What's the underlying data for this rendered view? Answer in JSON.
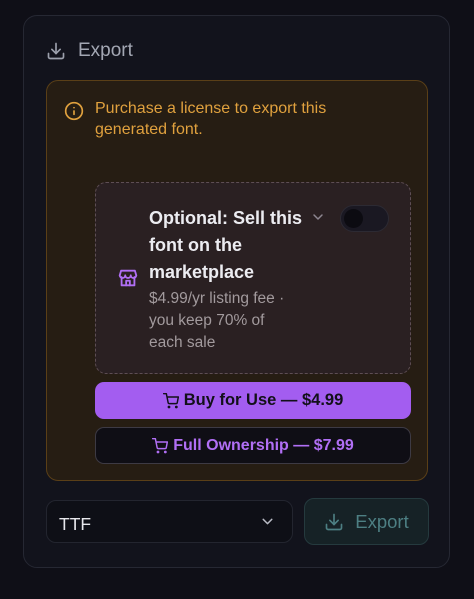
{
  "header": {
    "title": "Export",
    "icon": "download-icon"
  },
  "notice": {
    "icon": "info-icon",
    "text": "Purchase a license to export this generated font."
  },
  "marketplace": {
    "icon": "store-icon",
    "title": "Optional: Sell this font on the marketplace",
    "subtitle": "$4.99/yr listing fee · you keep 70% of each sale",
    "toggle_on": false
  },
  "buttons": {
    "buy_label": "Buy for Use — $4.99",
    "ownership_label": "Full Ownership — $7.99",
    "export_label": "Export"
  },
  "format_select": {
    "value": "TTF"
  },
  "colors": {
    "accent": "#a35df0",
    "warning": "#e0a13e",
    "export_disabled": "#4d7f83"
  }
}
